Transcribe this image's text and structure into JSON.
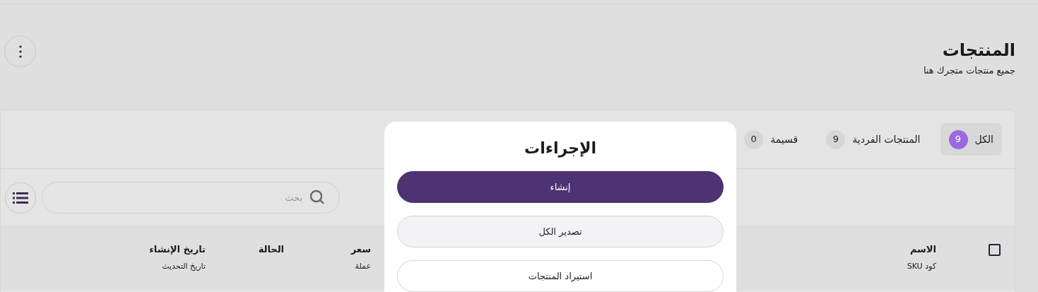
{
  "page": {
    "title": "المنتجات",
    "subtitle": "جميع منتجات متجرك هنا"
  },
  "tabs": [
    {
      "label": "الكل",
      "count": "9",
      "selected": true
    },
    {
      "label": "المنتجات الفردية",
      "count": "9",
      "selected": false
    },
    {
      "label": "قسيمة",
      "count": "0",
      "selected": false
    }
  ],
  "search": {
    "placeholder": "بحث"
  },
  "table": {
    "select_all": {
      "checked": false
    },
    "columns": [
      {
        "title": "الاسم",
        "subtitle": "كود SKU"
      },
      {
        "title": "سعر",
        "subtitle": "عملة"
      },
      {
        "title": "الحالة"
      },
      {
        "title": "تاريخ الإنشاء",
        "subtitle": "تاريخ التحديث"
      }
    ]
  },
  "actions_sheet": {
    "title": "الإجراءات",
    "buttons": [
      {
        "label": "إنشاء",
        "kind": "primary"
      },
      {
        "label": "تصدير الكل",
        "kind": "secondary"
      },
      {
        "label": "استيراد المنتجات",
        "kind": "outline"
      }
    ]
  }
}
